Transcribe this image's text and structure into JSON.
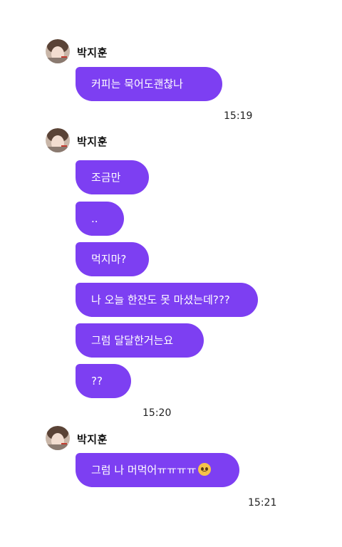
{
  "colors": {
    "bubble": "#7d3ff2",
    "background": "#ffffff"
  },
  "groups": [
    {
      "sender": "박지훈",
      "avatar_icon": "profile-photo",
      "messages": [
        "커피는 묵어도괜찮나"
      ],
      "time": "15:19"
    },
    {
      "sender": "박지훈",
      "avatar_icon": "profile-photo",
      "messages": [
        "조금만",
        "..",
        "먹지마?",
        "나 오늘 한잔도 못 마셨는데???",
        "그럼 달달한거는요",
        "??"
      ],
      "time": "15:20"
    },
    {
      "sender": "박지훈",
      "avatar_icon": "profile-photo",
      "messages": [
        "그럼 나 머먹어ㅠㅠㅠㅠ"
      ],
      "emoji": "pleading-face-emoji",
      "time": "15:21"
    }
  ]
}
